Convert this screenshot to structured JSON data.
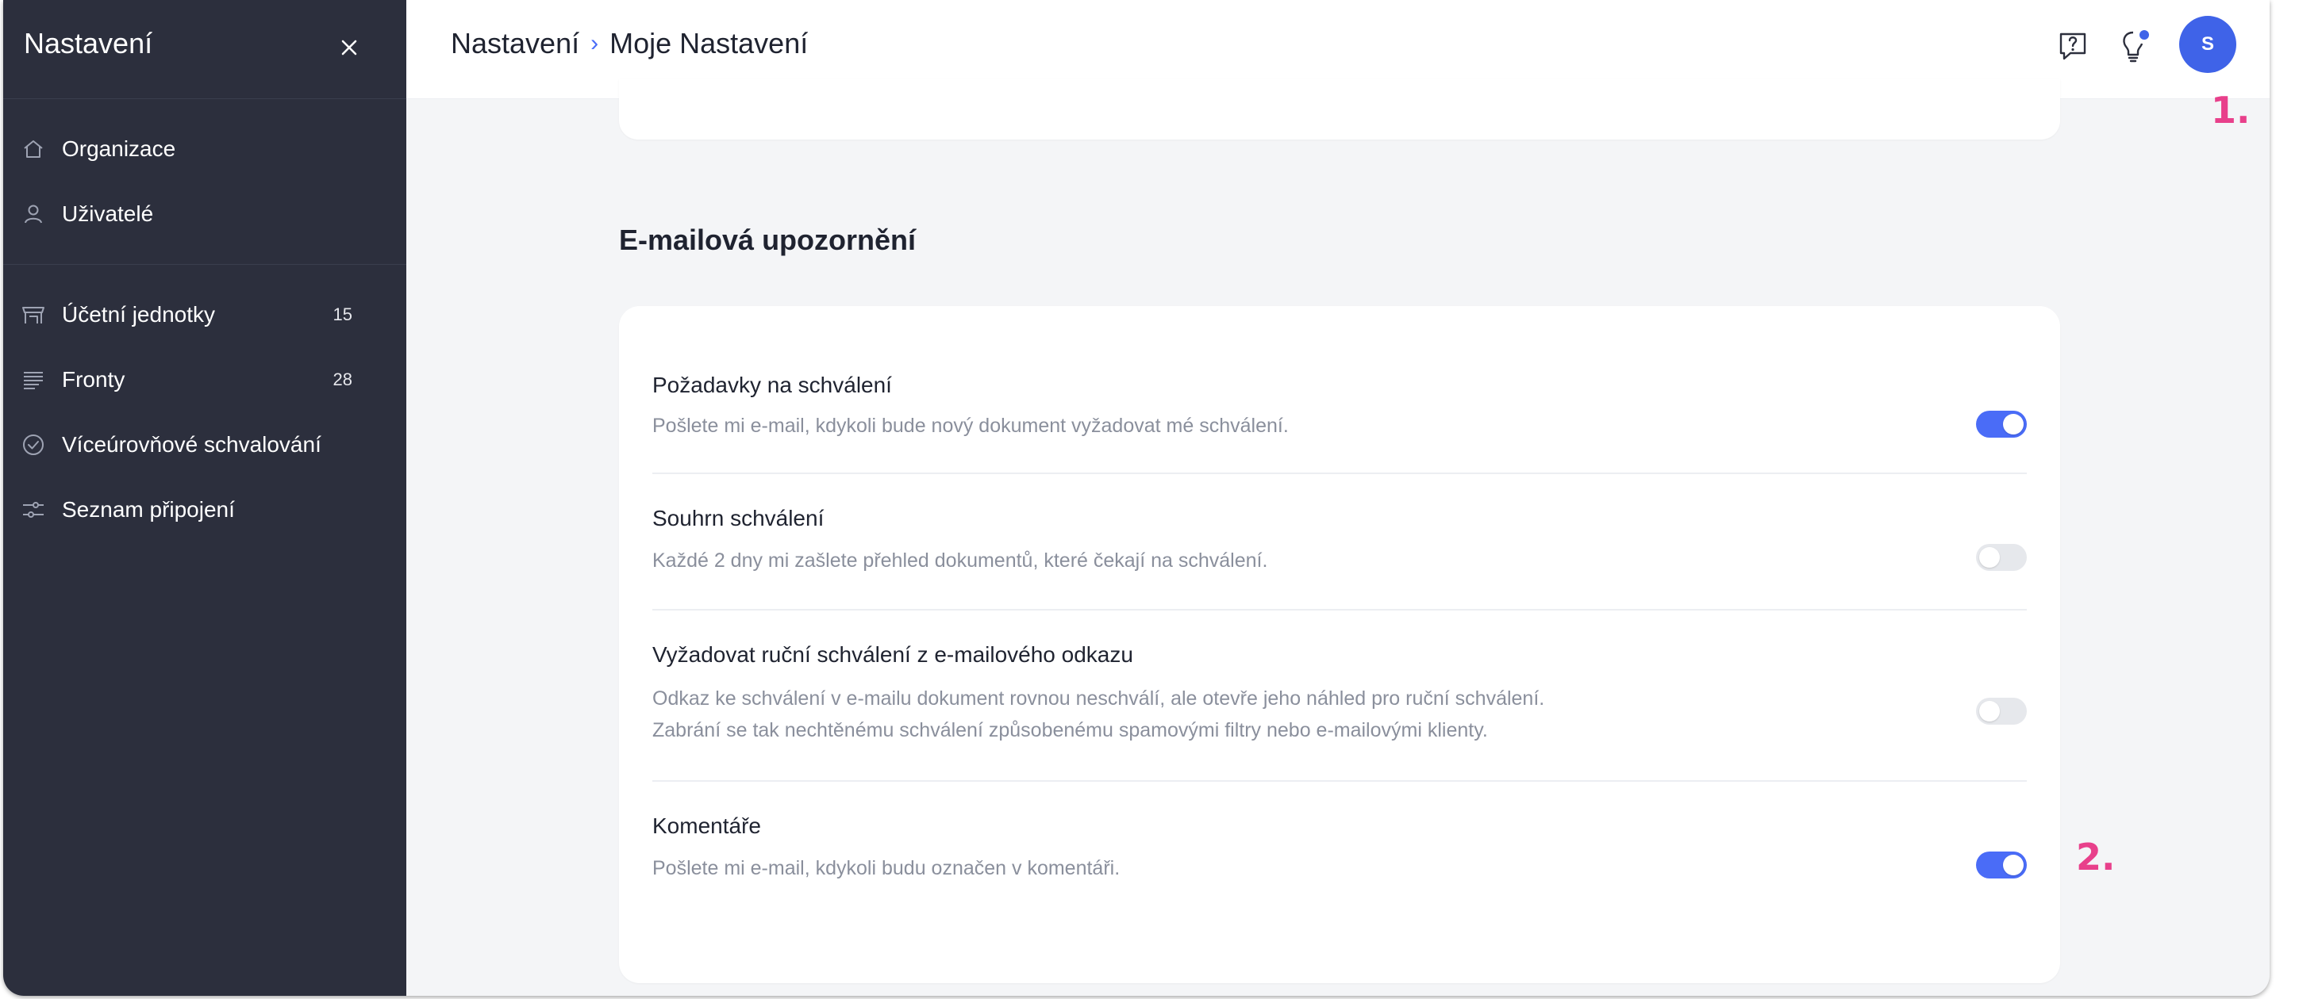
{
  "sidebar": {
    "title": "Nastavení",
    "group1": [
      {
        "label": "Organizace",
        "icon": "home-icon"
      },
      {
        "label": "Uživatelé",
        "icon": "user-icon"
      }
    ],
    "group2": [
      {
        "label": "Účetní jednotky",
        "count": "15",
        "icon": "store-icon"
      },
      {
        "label": "Fronty",
        "count": "28",
        "icon": "queue-lines-icon"
      },
      {
        "label": "Víceúrovňové schvalování",
        "icon": "check-circle-icon"
      },
      {
        "label": "Seznam připojení",
        "icon": "connections-icon"
      }
    ]
  },
  "header": {
    "breadcrumb": {
      "root": "Nastavení",
      "separator": "›",
      "current": "Moje Nastavení"
    },
    "avatar_initial": "S",
    "icons": [
      "help-chat-icon",
      "lightbulb-icon"
    ]
  },
  "annotations": [
    "1.",
    "2."
  ],
  "email_section": {
    "title": "E-mailová upozornění",
    "rows": [
      {
        "title": "Požadavky na schválení",
        "desc": [
          "Pošlete mi e-mail, kdykoli bude nový dokument vyžadovat mé schválení."
        ],
        "enabled": true
      },
      {
        "title": "Souhrn schválení",
        "desc": [
          "Každé 2 dny mi zašlete přehled dokumentů, které čekají na schválení."
        ],
        "enabled": false
      },
      {
        "title": "Vyžadovat ruční schválení z e-mailového odkazu",
        "desc": [
          "Odkaz ke schválení v e-mailu dokument rovnou neschválí, ale otevře jeho náhled pro ruční schválení.",
          "Zabrání se tak nechtěnému schválení způsobenému spamovými filtry nebo e-mailovými klienty."
        ],
        "enabled": false
      },
      {
        "title": "Komentáře",
        "desc": [
          "Pošlete mi e-mail, kdykoli budu označen v komentáři."
        ],
        "enabled": true
      }
    ]
  },
  "colors": {
    "sidebar_bg": "#2c2f3d",
    "accent": "#4a6cf7",
    "annotation": "#e8408b"
  }
}
